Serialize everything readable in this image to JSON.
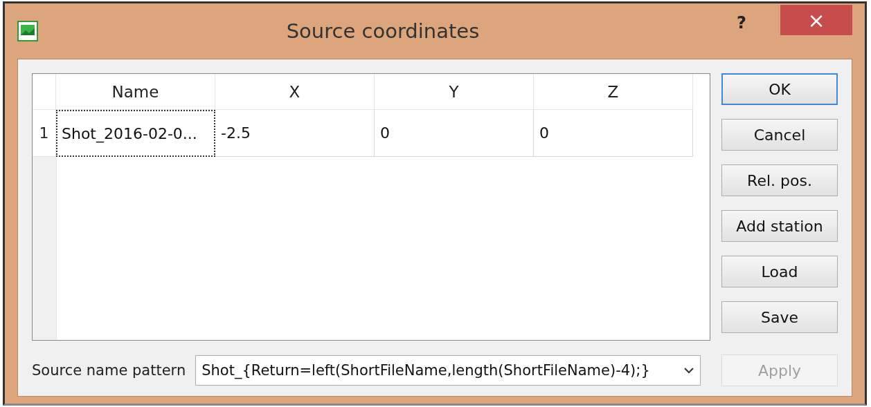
{
  "window": {
    "title": "Source coordinates",
    "help": "?",
    "close": "×"
  },
  "table": {
    "columns": [
      "Name",
      "X",
      "Y",
      "Z"
    ],
    "rows": [
      {
        "number": "1",
        "cells": [
          {
            "text": "Shot_2016-02-0...",
            "focused": true
          },
          {
            "text": "-2.5",
            "focused": false
          },
          {
            "text": "0",
            "focused": false
          },
          {
            "text": "0",
            "focused": false
          }
        ]
      }
    ]
  },
  "buttons": [
    {
      "label": "OK",
      "default": true,
      "disabled": false
    },
    {
      "label": "Cancel",
      "default": false,
      "disabled": false
    },
    {
      "label": "Rel. pos.",
      "default": false,
      "disabled": false
    },
    {
      "label": "Add station",
      "default": false,
      "disabled": false
    },
    {
      "label": "Load",
      "default": false,
      "disabled": false
    },
    {
      "label": "Save",
      "default": false,
      "disabled": false
    }
  ],
  "pattern": {
    "label": "Source name pattern",
    "value": "Shot_{Return=left(ShortFileName,length(ShortFileName)-4);}"
  },
  "apply_button": {
    "label": "Apply",
    "default": false,
    "disabled": true
  }
}
